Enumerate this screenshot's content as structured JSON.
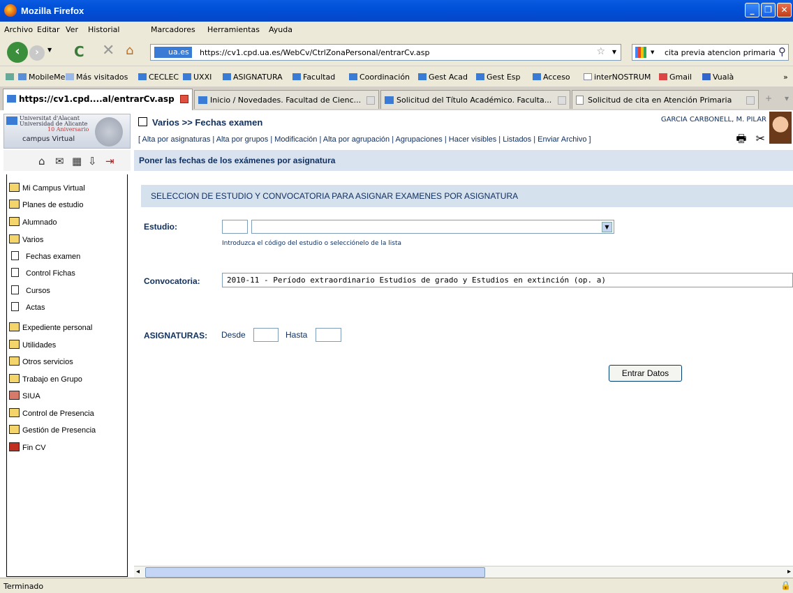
{
  "window": {
    "title": "Mozilla Firefox"
  },
  "menu": [
    "Archivo",
    "Editar",
    "Ver",
    "Historial",
    "Marcadores",
    "Herramientas",
    "Ayuda"
  ],
  "navigation": {
    "site_badge": "ua.es",
    "url": "https://cv1.cpd.ua.es/WebCv/CtrlZonaPersonal/entrarCv.asp",
    "search_query": "cita previa atencion primaria"
  },
  "bookmarks": [
    "MobileMe",
    "Más visitados",
    "CECLEC",
    "UXXI",
    "ASIGNATURA",
    "Facultad",
    "Coordinación",
    "Gest Acad",
    "Gest Esp",
    "Acceso",
    "interNOSTRUM",
    "Gmail",
    "Vualà"
  ],
  "tabs": [
    {
      "label": "https://cv1.cpd....al/entrarCv.asp",
      "active": true
    },
    {
      "label": "Inicio / Novedades. Facultad de Cienc...",
      "active": false
    },
    {
      "label": "Solicitud del Título Académico. Faculta...",
      "active": false
    },
    {
      "label": "Solicitud de cita en Atención Primaria",
      "active": false
    }
  ],
  "campus": {
    "univ_line1": "Universitat d'Alacant",
    "univ_line2": "Universidad de Alicante",
    "univ_line3": "10 Aniversario",
    "label": "campus Virtual"
  },
  "sidebar": [
    "Mi Campus Virtual",
    "Planes de estudio",
    "Alumnado",
    "Varios",
    "Fechas examen",
    "Control Fichas",
    "Cursos",
    "Actas",
    "Expediente personal",
    "Utilidades",
    "Otros servicios",
    "Trabajo en Grupo",
    "SIUA",
    "Control de Presencia",
    "Gestión de Presencia",
    "Fin CV"
  ],
  "header": {
    "title": "Varios >> Fechas examen",
    "links": "[ Alta por asignaturas | Alta por grupos | Modificación | Alta por agrupación | Agrupaciones | Hacer visibles | Listados | Enviar Archivo ]",
    "user": "GARCIA CARBONELL, M. PILAR",
    "subtitle": "Poner las fechas de los exámenes por asignatura"
  },
  "form": {
    "section_title": "SELECCION DE ESTUDIO Y CONVOCATORIA PARA ASIGNAR EXAMENES POR ASIGNATURA",
    "estudio_label": "Estudio:",
    "estudio_hint": "Introduzca el código del estudio o selecciónelo de la lista",
    "convocatoria_label": "Convocatoria:",
    "convocatoria_value": "2010-11 - Período extraordinario Estudios de grado y Estudios en extinción (op. a)",
    "asignaturas_label": "ASIGNATURAS:",
    "desde_label": "Desde",
    "hasta_label": "Hasta",
    "submit_label": "Entrar Datos"
  },
  "status": {
    "text": "Terminado"
  }
}
